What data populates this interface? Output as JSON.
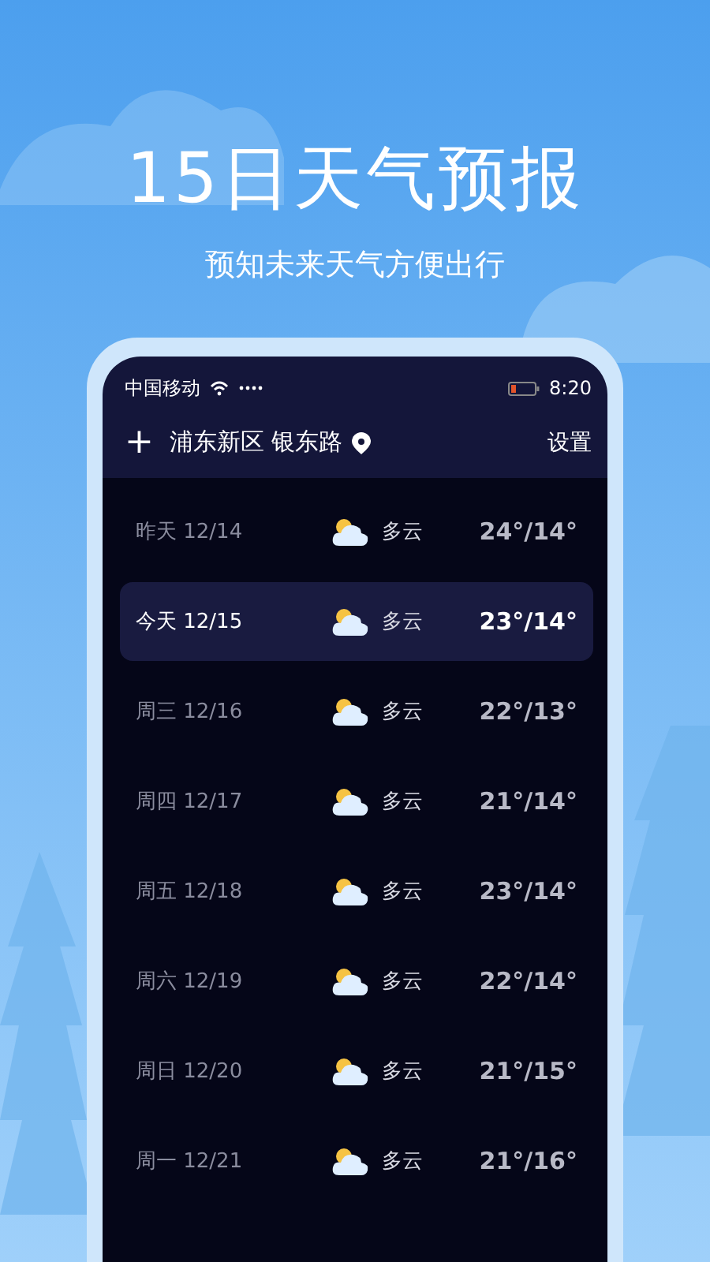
{
  "headline": "15日天气预报",
  "subheadline": "预知未来天气方便出行",
  "status_bar": {
    "carrier": "中国移动",
    "time": "8:20"
  },
  "header": {
    "add_icon": "+",
    "location": "浦东新区 银东路",
    "settings": "设置"
  },
  "days": [
    {
      "date": "昨天 12/14",
      "condition": "多云",
      "temps": "24°/14°",
      "selected": false
    },
    {
      "date": "今天 12/15",
      "condition": "多云",
      "temps": "23°/14°",
      "selected": true
    },
    {
      "date": "周三 12/16",
      "condition": "多云",
      "temps": "22°/13°",
      "selected": false
    },
    {
      "date": "周四 12/17",
      "condition": "多云",
      "temps": "21°/14°",
      "selected": false
    },
    {
      "date": "周五 12/18",
      "condition": "多云",
      "temps": "23°/14°",
      "selected": false
    },
    {
      "date": "周六 12/19",
      "condition": "多云",
      "temps": "22°/14°",
      "selected": false
    },
    {
      "date": "周日 12/20",
      "condition": "多云",
      "temps": "21°/15°",
      "selected": false
    },
    {
      "date": "周一 12/21",
      "condition": "多云",
      "temps": "21°/16°",
      "selected": false
    }
  ]
}
